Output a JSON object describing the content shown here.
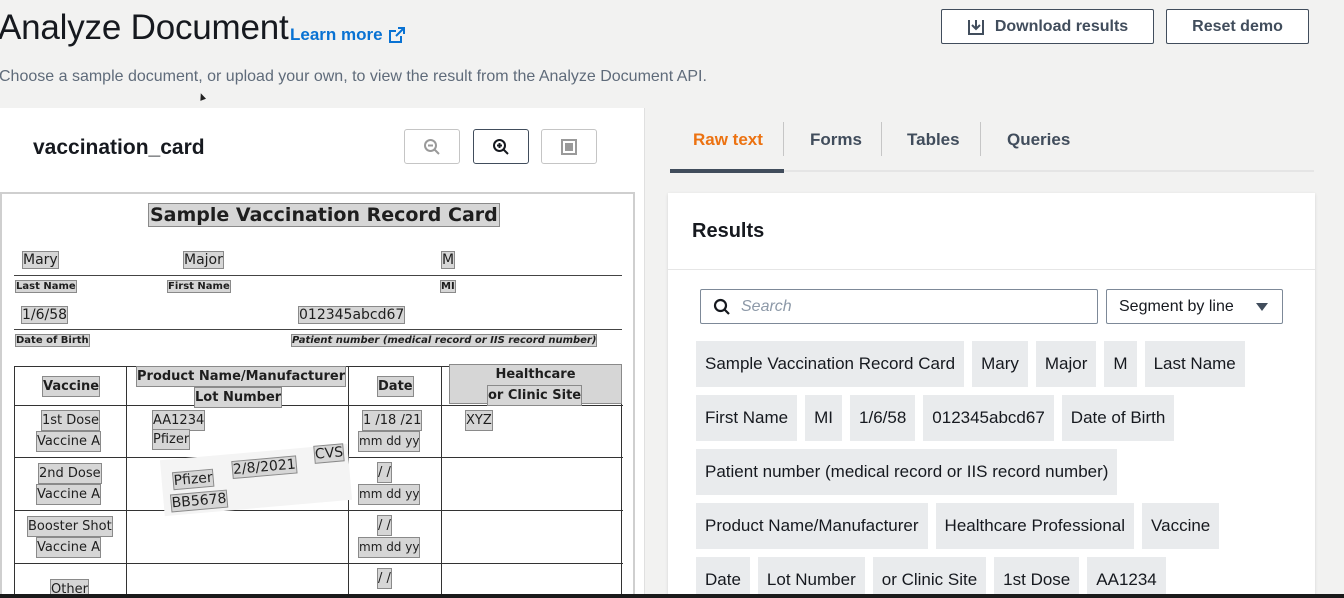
{
  "header": {
    "title": "Analyze Document",
    "learn_more": "Learn more",
    "subtitle": "Choose a sample document, or upload your own, to view the result from the Analyze Document API.",
    "download_label": "Download results",
    "reset_label": "Reset demo"
  },
  "document": {
    "name": "vaccination_card",
    "card_title": "Sample Vaccination Record Card",
    "first_row": {
      "last_name": "Mary",
      "first_name": "Major",
      "mi": "M"
    },
    "labels": {
      "last_name": "Last Name",
      "first_name": "First Name",
      "mi": "MI",
      "dob": "Date of Birth",
      "patient_number": "Patient number (medical record or IIS record number)"
    },
    "dob": "1/6/58",
    "patient_number": "012345abcd67",
    "table": {
      "headers": {
        "vaccine": "Vaccine",
        "product_1": "Product Name/Manufacturer",
        "product_2": "Lot Number",
        "date": "Date",
        "hcp_1": "Healthcare Professional",
        "hcp_2": "or Clinic Site"
      },
      "rows": [
        {
          "dose": "1st Dose",
          "vaccine": "Vaccine A",
          "lot": "AA1234",
          "maker": "Pfizer",
          "date": "1 /18 /21",
          "date_hint": "mm dd  yy",
          "site": "XYZ"
        },
        {
          "dose": "2nd Dose",
          "vaccine": "Vaccine A",
          "date": "/    /",
          "date_hint": "mm dd  yy"
        },
        {
          "dose": "Booster Shot",
          "vaccine": "Vaccine A",
          "date": "/    /",
          "date_hint": "mm dd  yy"
        },
        {
          "dose": "Other",
          "date": "/    /"
        }
      ],
      "sticker": {
        "maker": "Pfizer",
        "date": "2/8/2021",
        "site": "CVS",
        "lot": "BB5678"
      }
    }
  },
  "tabs": [
    "Raw text",
    "Forms",
    "Tables",
    "Queries"
  ],
  "results": {
    "title": "Results",
    "search_placeholder": "Search",
    "segment_label": "Segment by line",
    "chips": [
      [
        "Sample Vaccination Record Card",
        "Mary",
        "Major",
        "M",
        "Last Name"
      ],
      [
        "First Name",
        "MI",
        "1/6/58",
        "012345abcd67",
        "Date of Birth"
      ],
      [
        "Patient number (medical record or IIS record number)"
      ],
      [
        "Product Name/Manufacturer",
        "Healthcare Professional",
        "Vaccine"
      ],
      [
        "Date",
        "Lot Number",
        "or Clinic Site",
        "1st Dose",
        "AA1234"
      ]
    ]
  },
  "colors": {
    "accent_link": "#0972d3",
    "active_tab": "#ec7211",
    "chip_bg": "#e9ebed"
  },
  "icons": [
    "external-link-icon",
    "download-icon",
    "zoom-out-icon",
    "zoom-in-icon",
    "fit-page-icon",
    "search-icon",
    "caret-down-icon"
  ]
}
